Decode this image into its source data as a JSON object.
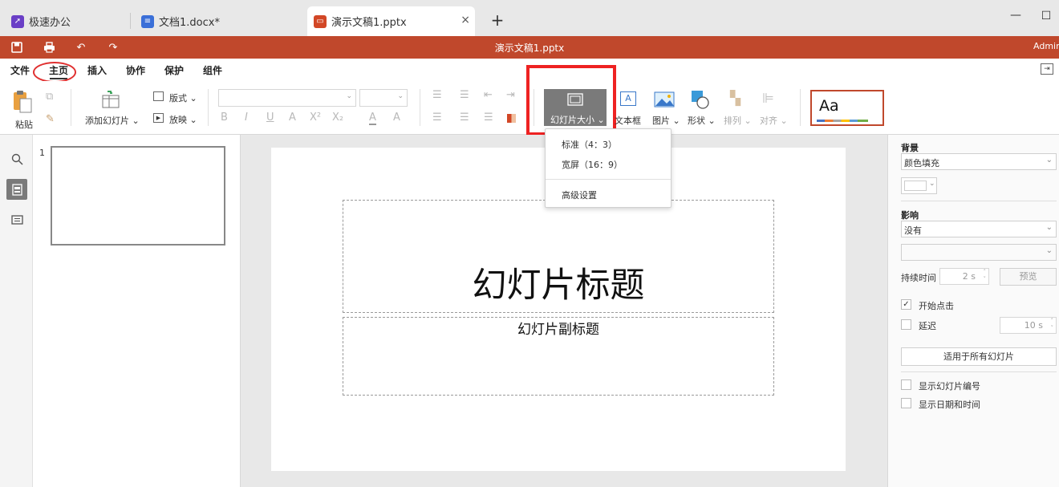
{
  "tabs": [
    {
      "label": "极速办公",
      "icon": "rocket-icon",
      "color": "#6a3fc6"
    },
    {
      "label": "文档1.docx*",
      "icon": "doc-icon",
      "color": "#3a6fd8"
    },
    {
      "label": "演示文稿1.pptx",
      "icon": "ppt-icon",
      "color": "#d24726"
    }
  ],
  "window": {
    "minimize": "—",
    "maximize": "☐",
    "new_tab": "+",
    "close_tab": "×"
  },
  "titlebar": {
    "title": "演示文稿1.pptx",
    "user": "Admin",
    "accent": "#c0482c"
  },
  "menu": [
    "文件",
    "主页",
    "插入",
    "协作",
    "保护",
    "组件"
  ],
  "ribbon": {
    "paste": "粘贴",
    "add_slide": "添加幻灯片",
    "layout": "版式",
    "play": "放映",
    "slide_size": "幻灯片大小",
    "textbox": "文本框",
    "image": "图片",
    "shape": "形状",
    "arrange": "排列",
    "align": "对齐",
    "theme_preview": "Aa",
    "font_buttons": [
      "B",
      "I",
      "U",
      "A",
      "X²",
      "X₂"
    ]
  },
  "dropdown": {
    "items": [
      "标准（4：3）",
      "宽屏（16：9）",
      "高级设置"
    ]
  },
  "thumbnails": [
    {
      "number": "1"
    }
  ],
  "slide": {
    "title": "幻灯片标题",
    "subtitle": "幻灯片副标题"
  },
  "right_panel": {
    "background_label": "背景",
    "background_value": "颜色填充",
    "effect_label": "影响",
    "effect_value": "没有",
    "duration_label": "持续时间",
    "duration_value": "2 s",
    "preview_button": "预览",
    "start_on_click": "开始点击",
    "delay_label": "延迟",
    "delay_value": "10 s",
    "apply_all_button": "适用于所有幻灯片",
    "show_slide_number": "显示幻灯片编号",
    "show_datetime": "显示日期和时间"
  }
}
